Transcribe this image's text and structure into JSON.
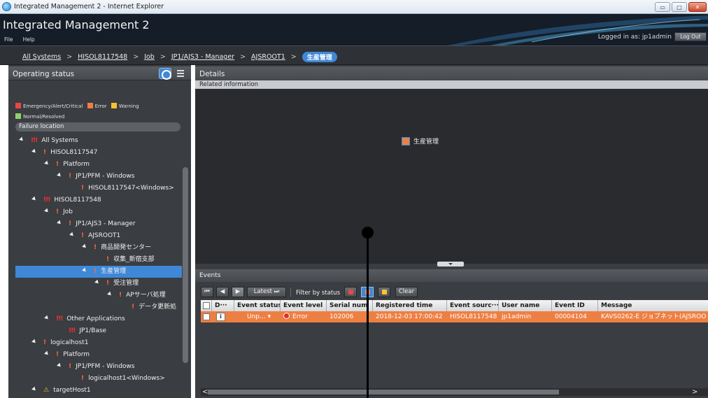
{
  "window": {
    "title": "Integrated Management 2 - Internet Explorer",
    "min_glyph": "▭",
    "max_glyph": "□",
    "close_glyph": "✕"
  },
  "app": {
    "title": "Integrated Management 2",
    "menu": [
      "File",
      "Help"
    ],
    "login_text": "Logged in as: jp1admin",
    "logout_label": "Log Out"
  },
  "breadcrumb": {
    "items": [
      "All Systems",
      "HISOL8117548",
      "Job",
      "JP1/AJS3 - Manager",
      "AJSROOT1"
    ],
    "separator": ">",
    "current": "生産管理"
  },
  "operating_status": {
    "title": "Operating status",
    "legend": [
      {
        "label": "Emergency/Alert/Critical",
        "color": "#e84848"
      },
      {
        "label": "Error",
        "color": "#ee7f42"
      },
      {
        "label": "Warning",
        "color": "#f4c430"
      },
      {
        "label": "Normal/Resolved",
        "color": "#8ed36a"
      }
    ],
    "failure_location_label": "Failure location",
    "tree": [
      {
        "label": "All Systems",
        "depth": 0,
        "sev": "multi",
        "mark": "!!!",
        "expanded": true
      },
      {
        "label": "HISOL8117547",
        "depth": 1,
        "sev": "err",
        "mark": "!",
        "expanded": true
      },
      {
        "label": "Platform",
        "depth": 2,
        "sev": "err",
        "mark": "!",
        "expanded": true
      },
      {
        "label": "JP1/PFM - Windows",
        "depth": 3,
        "sev": "err",
        "mark": "!",
        "expanded": true
      },
      {
        "label": "HISOL8117547<Windows>",
        "depth": 4,
        "sev": "err",
        "mark": "!",
        "expanded": false
      },
      {
        "label": "HISOL8117548",
        "depth": 1,
        "sev": "multi",
        "mark": "!!!",
        "expanded": true
      },
      {
        "label": "Job",
        "depth": 2,
        "sev": "err",
        "mark": "!",
        "expanded": true
      },
      {
        "label": "JP1/AJS3 - Manager",
        "depth": 3,
        "sev": "err",
        "mark": "!",
        "expanded": true
      },
      {
        "label": "AJSROOT1",
        "depth": 4,
        "sev": "err",
        "mark": "!",
        "expanded": true
      },
      {
        "label": "商品開発センター",
        "depth": 5,
        "sev": "err",
        "mark": "!",
        "expanded": true
      },
      {
        "label": "収集_新宿支部",
        "depth": 6,
        "sev": "err",
        "mark": "!",
        "expanded": false
      },
      {
        "label": "生産管理",
        "depth": 5,
        "sev": "err",
        "mark": "!",
        "expanded": true,
        "selected": true
      },
      {
        "label": "受注管理",
        "depth": 6,
        "sev": "err",
        "mark": "!",
        "expanded": true
      },
      {
        "label": "APサーバ処理",
        "depth": 7,
        "sev": "err",
        "mark": "!",
        "expanded": true
      },
      {
        "label": "データ更新処",
        "depth": 8,
        "sev": "err",
        "mark": "!",
        "expanded": false
      },
      {
        "label": "Other Applications",
        "depth": 2,
        "sev": "multi",
        "mark": "!!!",
        "expanded": true
      },
      {
        "label": "JP1/Base",
        "depth": 3,
        "sev": "multi",
        "mark": "!!!",
        "expanded": false
      },
      {
        "label": "logicalhost1",
        "depth": 1,
        "sev": "err",
        "mark": "!",
        "expanded": true
      },
      {
        "label": "Platform",
        "depth": 2,
        "sev": "err",
        "mark": "!",
        "expanded": true
      },
      {
        "label": "JP1/PFM - Windows",
        "depth": 3,
        "sev": "err",
        "mark": "!",
        "expanded": true
      },
      {
        "label": "logicalhost1<Windows>",
        "depth": 4,
        "sev": "err",
        "mark": "!",
        "expanded": false
      },
      {
        "label": "targetHost1",
        "depth": 1,
        "sev": "warn",
        "mark": "⚠",
        "expanded": true
      }
    ]
  },
  "details": {
    "title": "Details",
    "related_label": "Related information",
    "node_label": "生産管理"
  },
  "events": {
    "title": "Events",
    "toolbar": {
      "first": "⏮",
      "prev": "◀",
      "next": "▶",
      "latest": "Latest ⏭",
      "filter_label": "Filter by status",
      "clear": "Clear"
    },
    "columns": [
      "D···",
      "Event status",
      "Event level",
      "Serial num",
      "Registered time",
      "Event sourc···",
      "User name",
      "Event ID",
      "Message"
    ],
    "rows": [
      {
        "info": "i",
        "status": "Unp... ▾",
        "level": "Error",
        "serial": "102006",
        "time": "2018-12-03 17:00:42",
        "source": "HISOL8117548",
        "user": "jp1admin",
        "event_id": "00004104",
        "message": "KAVS0262-E ジョブネット(AJSROO"
      }
    ],
    "scroll_left": "<",
    "scroll_right": ">"
  },
  "colors": {
    "error_row": "#ee7f42",
    "accent": "#3f88d8"
  }
}
